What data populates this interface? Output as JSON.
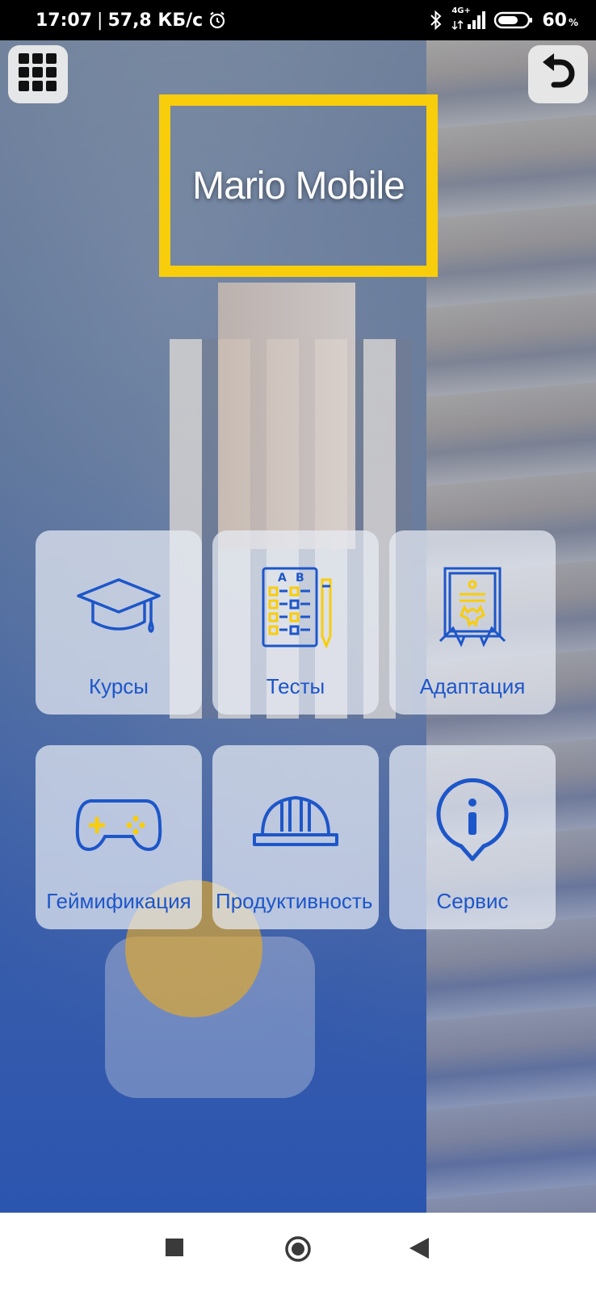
{
  "status_bar": {
    "time": "17:07",
    "separator": "|",
    "net_speed": "57,8 КБ/с",
    "network_type": "4G+",
    "battery_level": "60",
    "battery_unit": "%",
    "icons": [
      "alarm-icon",
      "bluetooth-icon",
      "signal-icon",
      "battery-icon"
    ]
  },
  "header": {
    "menu_icon": "grid-icon",
    "back_icon": "undo-arrow-icon"
  },
  "logo": {
    "text": "Mario Mobile",
    "frame_color": "#f8cd0b"
  },
  "tiles": [
    {
      "label": "Курсы",
      "icon": "graduation-cap-icon"
    },
    {
      "label": "Тесты",
      "icon": "test-sheet-icon"
    },
    {
      "label": "Адаптация",
      "icon": "certificate-icon"
    },
    {
      "label": "Геймификация",
      "icon": "gamepad-icon"
    },
    {
      "label": "Продуктивность",
      "icon": "hard-hat-icon"
    },
    {
      "label": "Сервис",
      "icon": "info-pin-icon"
    }
  ],
  "colors": {
    "accent_blue": "#1d56c9",
    "accent_yellow": "#f8cd0b"
  },
  "nav_bar": {
    "icons": [
      "square-icon",
      "circle-icon",
      "triangle-back-icon"
    ]
  }
}
